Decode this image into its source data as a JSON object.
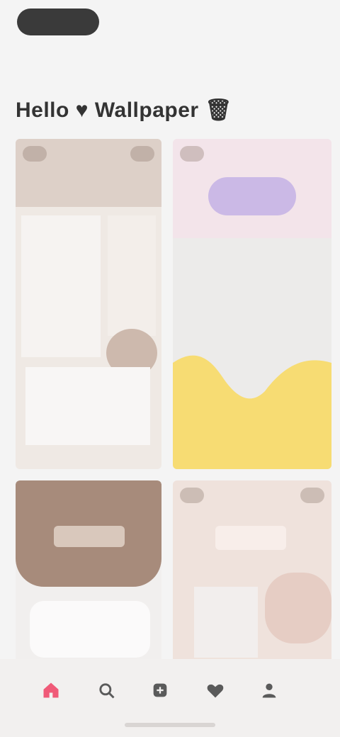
{
  "page": {
    "title": "Hello ♥ Wallpaper 🗑",
    "accent": "#f05a78"
  },
  "nav": {
    "items": [
      {
        "name": "home-icon",
        "active": true
      },
      {
        "name": "search-icon",
        "active": false
      },
      {
        "name": "add-icon",
        "active": false
      },
      {
        "name": "favorites-icon",
        "active": false
      },
      {
        "name": "profile-icon",
        "active": false
      }
    ]
  },
  "colors": {
    "bg": "#f4f4f4",
    "yellow": "#f7dc73",
    "purple": "#cbb9e6",
    "brown": "#a78b7b"
  }
}
